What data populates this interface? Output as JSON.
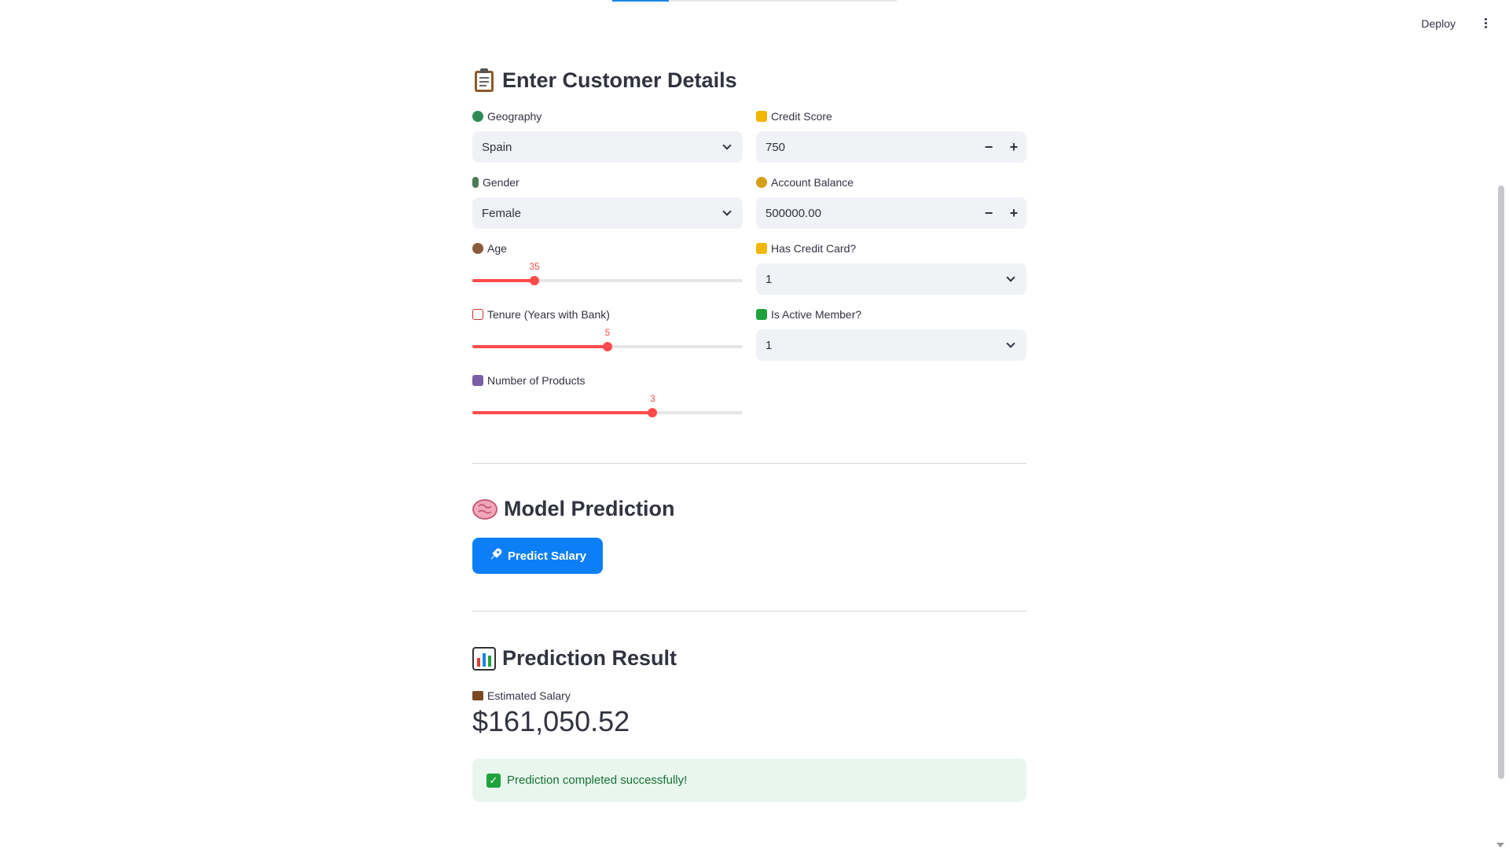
{
  "toolbar": {
    "deploy_label": "Deploy",
    "menu_icon": "more-vertical-icon"
  },
  "customer_section": {
    "title": "Enter Customer Details",
    "icon": "clipboard-icon",
    "fields": {
      "geography": {
        "label": "Geography",
        "icon": "globe-icon",
        "value": "Spain"
      },
      "credit_score": {
        "label": "Credit Score",
        "icon": "credit-card-icon",
        "value": "750"
      },
      "gender": {
        "label": "Gender",
        "icon": "person-icon",
        "value": "Female"
      },
      "account_balance": {
        "label": "Account Balance",
        "icon": "money-bag-icon",
        "value": "500000.00"
      },
      "age": {
        "label": "Age",
        "icon": "cake-icon",
        "value": "35",
        "fraction": 0.23
      },
      "has_credit_card": {
        "label": "Has Credit Card?",
        "icon": "credit-card-icon",
        "value": "1"
      },
      "tenure": {
        "label": "Tenure (Years with Bank)",
        "icon": "calendar-icon",
        "value": "5",
        "fraction": 0.5
      },
      "is_active_member": {
        "label": "Is Active Member?",
        "icon": "check-box-icon",
        "value": "1"
      },
      "num_products": {
        "label": "Number of Products",
        "icon": "shopping-bags-icon",
        "value": "3",
        "fraction": 0.667
      }
    },
    "stepper": {
      "minus": "−",
      "plus": "+"
    }
  },
  "model_section": {
    "title": "Model Prediction",
    "icon": "brain-icon",
    "button_label": "Predict Salary",
    "button_icon": "rocket-icon"
  },
  "result_section": {
    "title": "Prediction Result",
    "icon": "bar-chart-icon",
    "metric_label": "Estimated Salary",
    "metric_icon": "briefcase-icon",
    "metric_value": "$161,050.52",
    "success_message": "Prediction completed successfully!"
  },
  "colors": {
    "accent": "#ff4b4b",
    "primary_button": "#0d7ff6",
    "success_bg": "#e8f6ee",
    "success_text": "#177233"
  }
}
